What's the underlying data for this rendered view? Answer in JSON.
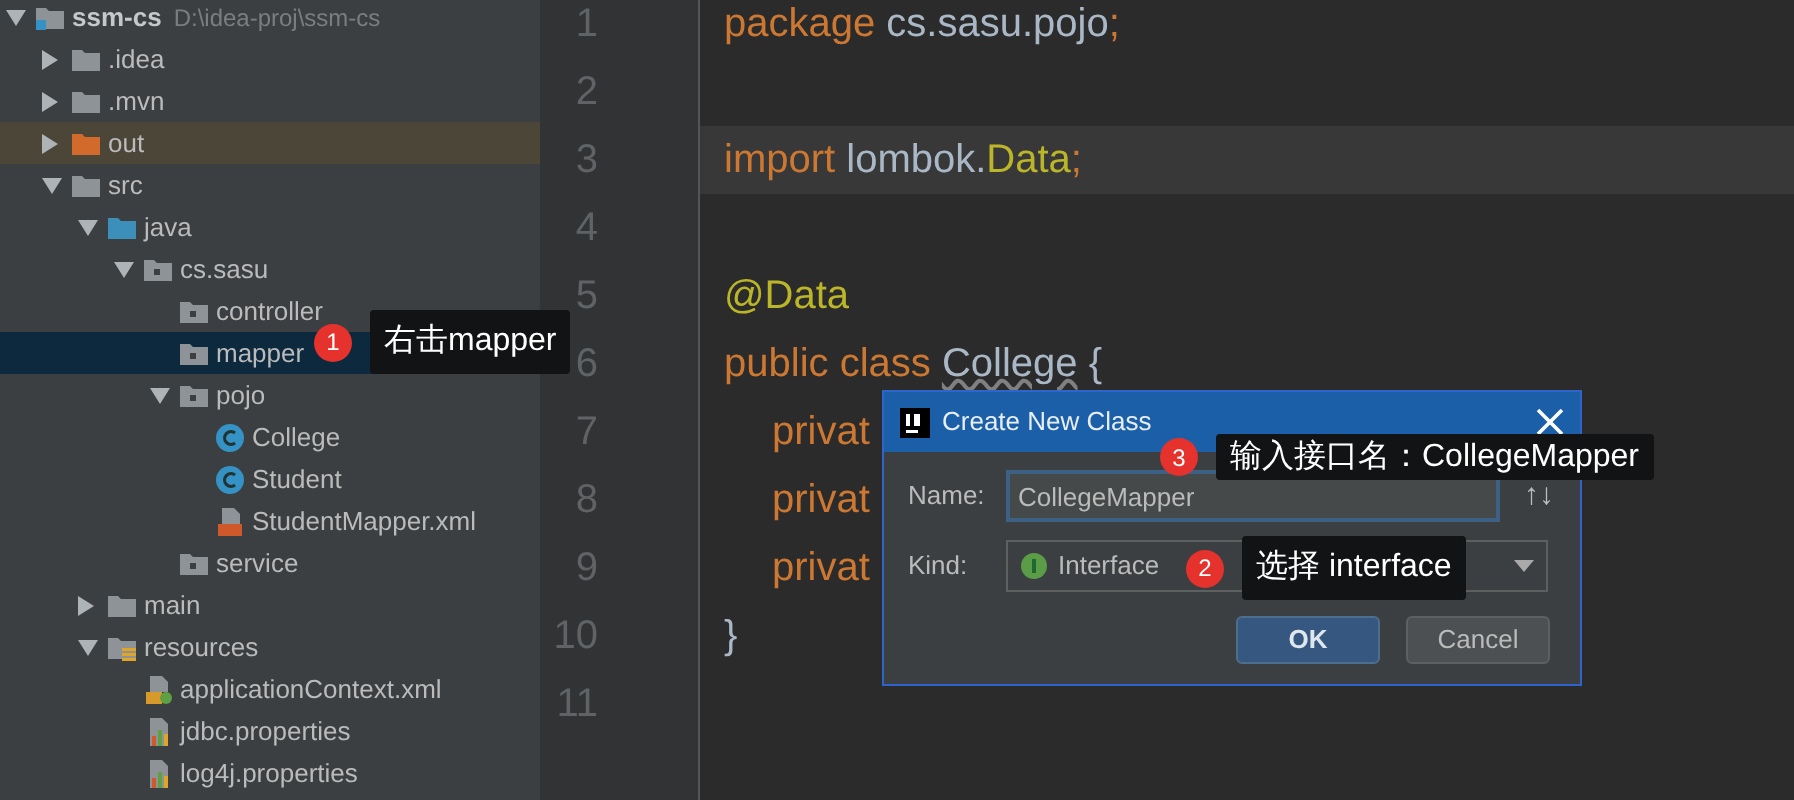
{
  "project_tree": [
    {
      "label": "ssm-cs",
      "path": "D:\\idea-proj\\ssm-cs",
      "kind": "module",
      "expanded": true,
      "selected": false,
      "children": [
        {
          "label": ".idea",
          "kind": "folder",
          "expanded": false,
          "selected": false
        },
        {
          "label": ".mvn",
          "kind": "folder",
          "expanded": false,
          "selected": false
        },
        {
          "label": "out",
          "kind": "excluded",
          "expanded": false,
          "selected": false
        },
        {
          "label": "src",
          "kind": "folder",
          "expanded": true,
          "selected": false,
          "children": [
            {
              "label": "java",
              "kind": "source",
              "expanded": true,
              "selected": false,
              "children": [
                {
                  "label": "cs.sasu",
                  "kind": "package",
                  "expanded": true,
                  "selected": false,
                  "children": [
                    {
                      "label": "controller",
                      "kind": "package",
                      "selected": false
                    },
                    {
                      "label": "mapper",
                      "kind": "package",
                      "selected": true
                    },
                    {
                      "label": "pojo",
                      "kind": "package",
                      "expanded": true,
                      "selected": false,
                      "children": [
                        {
                          "label": "College",
                          "kind": "class",
                          "selected": false
                        },
                        {
                          "label": "Student",
                          "kind": "class",
                          "selected": false
                        },
                        {
                          "label": "StudentMapper.xml",
                          "kind": "xml",
                          "selected": false
                        }
                      ]
                    },
                    {
                      "label": "service",
                      "kind": "package",
                      "selected": false
                    }
                  ]
                }
              ]
            },
            {
              "label": "main",
              "kind": "folder",
              "expanded": false,
              "selected": false
            },
            {
              "label": "resources",
              "kind": "resources",
              "expanded": true,
              "selected": false,
              "children": [
                {
                  "label": "applicationContext.xml",
                  "kind": "spring",
                  "selected": false
                },
                {
                  "label": "jdbc.properties",
                  "kind": "properties",
                  "selected": false
                },
                {
                  "label": "log4j.properties",
                  "kind": "properties",
                  "selected": false
                }
              ]
            }
          ]
        }
      ]
    }
  ],
  "editor": {
    "lines": [
      {
        "number": "1",
        "current": false,
        "tokens": [
          {
            "text": "package",
            "kind": "keyword"
          },
          {
            "text": " cs.sasu.pojo",
            "kind": "plain"
          },
          {
            "text": ";",
            "kind": "keyword"
          }
        ]
      },
      {
        "number": "2",
        "current": false
      },
      {
        "number": "3",
        "current": true,
        "tokens": [
          {
            "text": "import",
            "kind": "keyword"
          },
          {
            "text": " lombok.",
            "kind": "plain"
          },
          {
            "text": "Data",
            "kind": "annotation"
          },
          {
            "text": ";",
            "kind": "keyword"
          }
        ]
      },
      {
        "number": "4",
        "current": false
      },
      {
        "number": "5",
        "current": false,
        "tokens": [
          {
            "text": "@Data",
            "kind": "annotation"
          }
        ]
      },
      {
        "number": "6",
        "current": false,
        "tokens": [
          {
            "text": "public class ",
            "kind": "keyword"
          },
          {
            "text": "College",
            "kind": "warning"
          },
          {
            "text": " {",
            "kind": "plain"
          }
        ]
      },
      {
        "number": "7",
        "current": false,
        "indented": true,
        "tokens": [
          {
            "text": "privat",
            "kind": "keyword"
          }
        ]
      },
      {
        "number": "8",
        "current": false,
        "indented": true,
        "tokens": [
          {
            "text": "privat",
            "kind": "keyword"
          }
        ]
      },
      {
        "number": "9",
        "current": false,
        "indented": true,
        "tokens": [
          {
            "text": "privat",
            "kind": "keyword"
          }
        ]
      },
      {
        "number": "10",
        "current": false,
        "tokens": [
          {
            "text": "}",
            "kind": "plain"
          }
        ]
      },
      {
        "number": "11",
        "current": false
      }
    ]
  },
  "dialog": {
    "title": "Create New Class",
    "name_label": "Name:",
    "name_value": "CollegeMapper",
    "sort_icon": "↑↓",
    "kind_label": "Kind:",
    "kind_value": "Interface",
    "buttons": [
      {
        "label": "OK",
        "default": true
      },
      {
        "label": "Cancel",
        "default": false
      }
    ]
  },
  "callouts": [
    {
      "number": "1",
      "text": "右击mapper"
    },
    {
      "number": "3",
      "text": "输入接口名：CollegeMapper"
    },
    {
      "number": "2",
      "text": "选择 interface"
    }
  ]
}
